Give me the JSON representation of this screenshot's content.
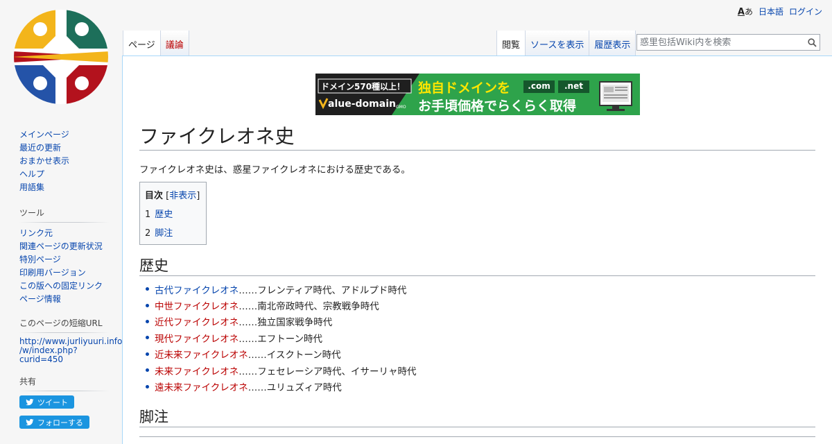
{
  "personal": {
    "lang_icon_a": "A",
    "lang_icon_b": "あ",
    "language": "日本語",
    "login": "ログイン"
  },
  "tabs_left": [
    {
      "label": "ページ",
      "selected": true
    },
    {
      "label": "議論",
      "selected": false,
      "red": true
    }
  ],
  "tabs_right": [
    {
      "label": "閲覧",
      "selected": true
    },
    {
      "label": "ソースを表示",
      "selected": false
    },
    {
      "label": "履歴表示",
      "selected": false
    }
  ],
  "search": {
    "placeholder": "惑里包括Wiki内を検索"
  },
  "banner": {
    "badge": "ドメイン570種以上！",
    "headline": "独自ドメインを",
    "tld1": ".com",
    "tld2": ".net",
    "brand": "alue-domain",
    "brand_suffix": "GMO",
    "sub": "お手頃価格でらくらく取得"
  },
  "page": {
    "title": "ファイクレオネ史",
    "intro": "ファイクレオネ史は、惑星ファイクレオネにおける歴史である。"
  },
  "toc": {
    "title": "目次",
    "toggle_open": "[",
    "toggle": "非表示",
    "toggle_close": "]",
    "items": [
      {
        "num": "1",
        "label": "歴史"
      },
      {
        "num": "2",
        "label": "脚注"
      }
    ]
  },
  "sections": {
    "history": "歴史",
    "notes": "脚注"
  },
  "history_items": [
    {
      "link": "古代ファイクレオネ",
      "link_color": "blue",
      "text": "……フレンティア時代、アドルプド時代"
    },
    {
      "link": "中世ファイクレオネ",
      "link_color": "red",
      "text": "……南北帝政時代、宗教戦争時代"
    },
    {
      "link": "近代ファイクレオネ",
      "link_color": "red",
      "text": "……独立国家戦争時代"
    },
    {
      "link": "現代ファイクレオネ",
      "link_color": "red",
      "text": "……エフトーン時代"
    },
    {
      "link": "近未来ファイクレオネ",
      "link_color": "red",
      "text": "……イスクトーン時代"
    },
    {
      "link": "未来ファイクレオネ",
      "link_color": "red",
      "text": "……フェセレーシア時代、イサーリャ時代"
    },
    {
      "link": "遠未来ファイクレオネ",
      "link_color": "red",
      "text": "……ユリュズィア時代"
    }
  ],
  "sidebar": {
    "nav": [
      "メインページ",
      "最近の更新",
      "おまかせ表示",
      "ヘルプ",
      "用語集"
    ],
    "tools_heading": "ツール",
    "tools": [
      "リンク元",
      "関連ページの更新状況",
      "特別ページ",
      "印刷用バージョン",
      "この版への固定リンク",
      "ページ情報"
    ],
    "shorturl_heading": "このページの短縮URL",
    "shorturl_lines": [
      "http://www.jurliyuuri.info",
      "/w/index.php?",
      "curid=450"
    ],
    "share_heading": "共有",
    "tweet": "ツイート",
    "follow": "フォローする"
  },
  "colors": {
    "link": "#0645ad",
    "redlink": "#ba0000",
    "twitter": "#1b95e0",
    "banner_green": "#2ea34b"
  }
}
